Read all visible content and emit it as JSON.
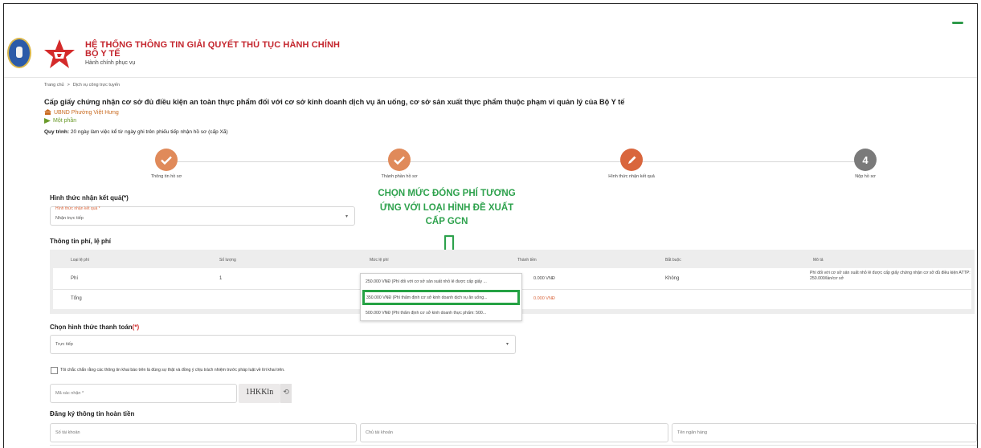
{
  "header": {
    "system_title": "HỆ THỐNG THÔNG TIN GIẢI QUYẾT THỦ TỤC HÀNH CHÍNH",
    "ministry": "BỘ Y TẾ",
    "tagline": "Hành chính phục vụ"
  },
  "breadcrumb": {
    "home": "Trang chủ",
    "sep": ">",
    "current": "Dịch vụ công trực tuyến"
  },
  "procedure": {
    "title": "Cấp giấy chứng nhận cơ sở đủ điều kiện an toàn thực phẩm đối với cơ sở kinh doanh dịch vụ ăn uống, cơ sở sản xuất thực phẩm thuộc phạm vi quản lý của Bộ Y tế",
    "agency": "UBND Phường Việt Hưng",
    "level": "Một phần",
    "flow_label": "Quy trình:",
    "flow_text": "20 ngày làm việc kể từ ngày ghi trên phiếu tiếp nhận hồ sơ (cấp Xã)"
  },
  "stepper": {
    "steps": [
      {
        "label": "Thông tin hồ sơ",
        "icon": "check-icon",
        "state": "done"
      },
      {
        "label": "Thành phần hồ sơ",
        "icon": "check-icon",
        "state": "done"
      },
      {
        "label": "Hình thức nhận kết quả",
        "icon": "pencil-icon",
        "state": "current"
      },
      {
        "label": "Nộp hồ sơ",
        "number": "4",
        "state": "todo"
      }
    ]
  },
  "result_method": {
    "heading": "Hình thức nhận kết quả(*)",
    "field_label": "Hình thức nhận kết quả *",
    "value": "Nhận trực tiếp"
  },
  "annotation": {
    "line1": "CHỌN MỨC ĐÓNG PHÍ TƯƠNG",
    "line2": "ỨNG VỚI LOẠI HÌNH ĐỀ XUẤT",
    "line3": "CẤP GCN",
    "color": "#2ea24d"
  },
  "fees": {
    "heading": "Thông tin phí, lệ phí",
    "columns": [
      "Loại lệ phí",
      "Số lượng",
      "Mức lệ phí",
      "Thành tiền",
      "Bắt buộc",
      "Mô tả"
    ],
    "row": {
      "type": "Phí",
      "quantity": "1",
      "amount": "0.000 VNĐ",
      "required": "Không",
      "description": "Phí đối với cơ sở sản xuất nhỏ lẻ được cấp giấy chứng nhận cơ sở đủ điều kiện ATTP: 250.000/lần/cơ sở"
    },
    "total_label": "Tổng",
    "total_amount": "0.000 VNĐ",
    "dropdown_options": [
      "250.000 VNĐ (Phí đối với cơ sở sản xuất nhỏ lẻ được cấp giấy ...",
      "350.000 VNĐ (Phí thẩm định cơ sở kinh doanh dịch vụ ăn uống...",
      "500.000 VNĐ (Phí thẩm định cơ sở kinh doanh thực phẩm: 500..."
    ],
    "highlight_color": "#25a244"
  },
  "payment": {
    "heading": "Chọn hình thức thanh toán",
    "required_mark": "(*)",
    "value": "Trực tiếp"
  },
  "commitment": {
    "text": "Tôi chắc chắn rằng các thông tin khai báo trên là đúng sự thật và đồng ý chịu trách nhiệm trước pháp luật về lời khai trên."
  },
  "captcha": {
    "placeholder": "Mã xác nhận *",
    "code": "1HKKln"
  },
  "refund": {
    "heading": "Đăng ký thông tin hoàn tiền",
    "account_number": "Số tài khoản",
    "account_holder": "Chủ tài khoản",
    "bank_name": "Tên ngân hàng"
  }
}
